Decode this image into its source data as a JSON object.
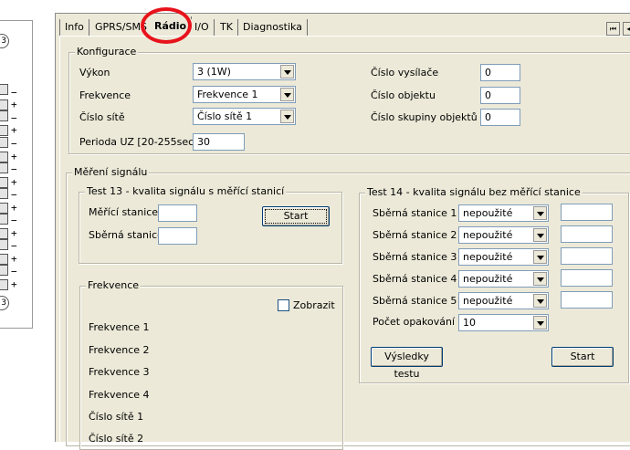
{
  "tabs": [
    {
      "label": "Info"
    },
    {
      "label": "GPRS/SMS"
    },
    {
      "label": "Rádio"
    },
    {
      "label": "I/O"
    },
    {
      "label": "TK"
    },
    {
      "label": "Diagnostika"
    }
  ],
  "left_panel": {
    "circle_top": "3",
    "circle_bottom": "3"
  },
  "konfigurace": {
    "title": "Konfigurace",
    "vykon_label": "Výkon",
    "vykon_value": "3 (1W)",
    "frekvence_label": "Frekvence",
    "frekvence_value": "Frekvence 1",
    "cislo_site_label": "Číslo sítě",
    "cislo_site_value": "Číslo sítě 1",
    "perioda_label": "Perioda UZ [20-255sec]",
    "perioda_value": "30",
    "cislo_vysilace_label": "Číslo vysílače",
    "cislo_vysilace_value": "0",
    "cislo_objektu_label": "Číslo objektu",
    "cislo_objektu_value": "0",
    "cislo_skupiny_label": "Číslo skupiny objektů",
    "cislo_skupiny_value": "0"
  },
  "mereni": {
    "title": "Měření signálu",
    "test13": {
      "title": "Test 13 - kvalita signálu s měřící stanicí",
      "merici_label": "Měřící stanice",
      "merici_value": "",
      "sberna_label": "Sběrná stanice",
      "sberna_value": "",
      "start_label": "Start"
    },
    "frekvence_box": {
      "title": "Frekvence",
      "zobrazit_label": "Zobrazit",
      "items": [
        "Frekvence 1",
        "Frekvence 2",
        "Frekvence 3",
        "Frekvence 4",
        "Číslo sítě 1",
        "Číslo sítě 2"
      ]
    },
    "test14": {
      "title": "Test 14 - kvalita signálu bez měřící stanice",
      "stations": [
        {
          "label": "Sběrná stanice 1",
          "value": "nepoužité",
          "result": ""
        },
        {
          "label": "Sběrná stanice 2",
          "value": "nepoužité",
          "result": ""
        },
        {
          "label": "Sběrná stanice 3",
          "value": "nepoužité",
          "result": ""
        },
        {
          "label": "Sběrná stanice 4",
          "value": "nepoužité",
          "result": ""
        },
        {
          "label": "Sběrná stanice 5",
          "value": "nepoužité",
          "result": ""
        }
      ],
      "pocet_label": "Počet opakování",
      "pocet_value": "10",
      "vysledky_label": "Výsledky testu",
      "start_label": "Start"
    }
  },
  "colors": {
    "highlight": "#e8121b",
    "window_bg": "#ece9d8",
    "field_border": "#7f9db9"
  }
}
